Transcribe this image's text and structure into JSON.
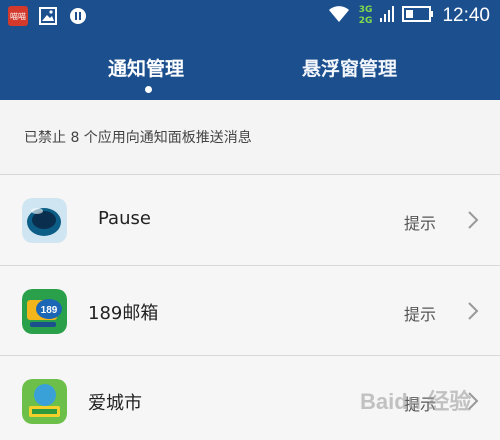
{
  "status_bar": {
    "left_icons": [
      "app-notification-icon",
      "image-icon",
      "pause-circle-icon"
    ],
    "app_badge_text": "喵喵",
    "network_top": "3G",
    "network_bottom": "2G",
    "time": "12:40",
    "right_icons": [
      "wifi-icon",
      "signal-icon",
      "battery-icon"
    ]
  },
  "tabs": [
    {
      "label": "通知管理",
      "active": true
    },
    {
      "label": "悬浮窗管理",
      "active": false
    }
  ],
  "notice": {
    "text": "已禁止 8 个应用向通知面板推送消息"
  },
  "apps": [
    {
      "name": "Pause",
      "status": "提示",
      "icon": "pause-app-icon"
    },
    {
      "name": "189邮箱",
      "status": "提示",
      "icon": "mail189-app-icon"
    },
    {
      "name": "爱城市",
      "status": "提示",
      "icon": "aicity-app-icon"
    }
  ],
  "watermark": "Baidu 经验",
  "colors": {
    "header_bg": "#1c4f8e",
    "list_bg": "#f6f6f6",
    "divider": "#d8d8d8"
  }
}
